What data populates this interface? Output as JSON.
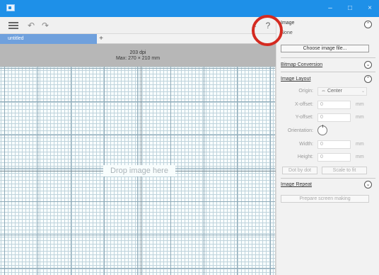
{
  "app": {
    "minimize_icon": "minimize-icon",
    "maximize_icon": "maximize-icon",
    "close_icon": "close-icon"
  },
  "toolbar": {
    "menu_icon": "menu-icon",
    "undo_icon": "undo-icon",
    "redo_icon": "redo-icon",
    "collapse_symbol": "‹",
    "help_label": "?"
  },
  "tabs": [
    {
      "label": "untitled",
      "active": true
    },
    {
      "label": "+",
      "active": false
    }
  ],
  "info": {
    "dpi": "203 dpi",
    "max_size": "Max: 270 × 210 mm"
  },
  "canvas": {
    "drop_text": "Drop image here"
  },
  "panel": {
    "image_section": {
      "title": "Image",
      "subtitle": "None",
      "choose_button": "Choose image file...",
      "expanded_symbol": "⌃"
    },
    "bitmap_section": {
      "title": "Bitmap Conversion",
      "collapsed_symbol": "⌄"
    },
    "layout_section": {
      "title": "Image Layout",
      "expanded_symbol": "⌃",
      "origin_label": "Origin:",
      "origin_value": "⇔ Center",
      "x_offset_label": "X-offset:",
      "x_offset_value": "0",
      "y_offset_label": "Y-offset:",
      "y_offset_value": "0",
      "orientation_label": "Orientation:",
      "width_label": "Width:",
      "width_value": "0",
      "height_label": "Height:",
      "height_value": "0",
      "unit": "mm",
      "dot_by_dot_button": "Dot by dot",
      "scale_to_fit_button": "Scale to fit"
    },
    "repeat_section": {
      "title": "Image Repeat",
      "collapsed_symbol": "⌄",
      "prepare_button": "Prepare screen making"
    }
  },
  "colors": {
    "titlebar": "#1e90e8",
    "active_tab": "#6fa0dd",
    "annotation": "#d42a20"
  }
}
